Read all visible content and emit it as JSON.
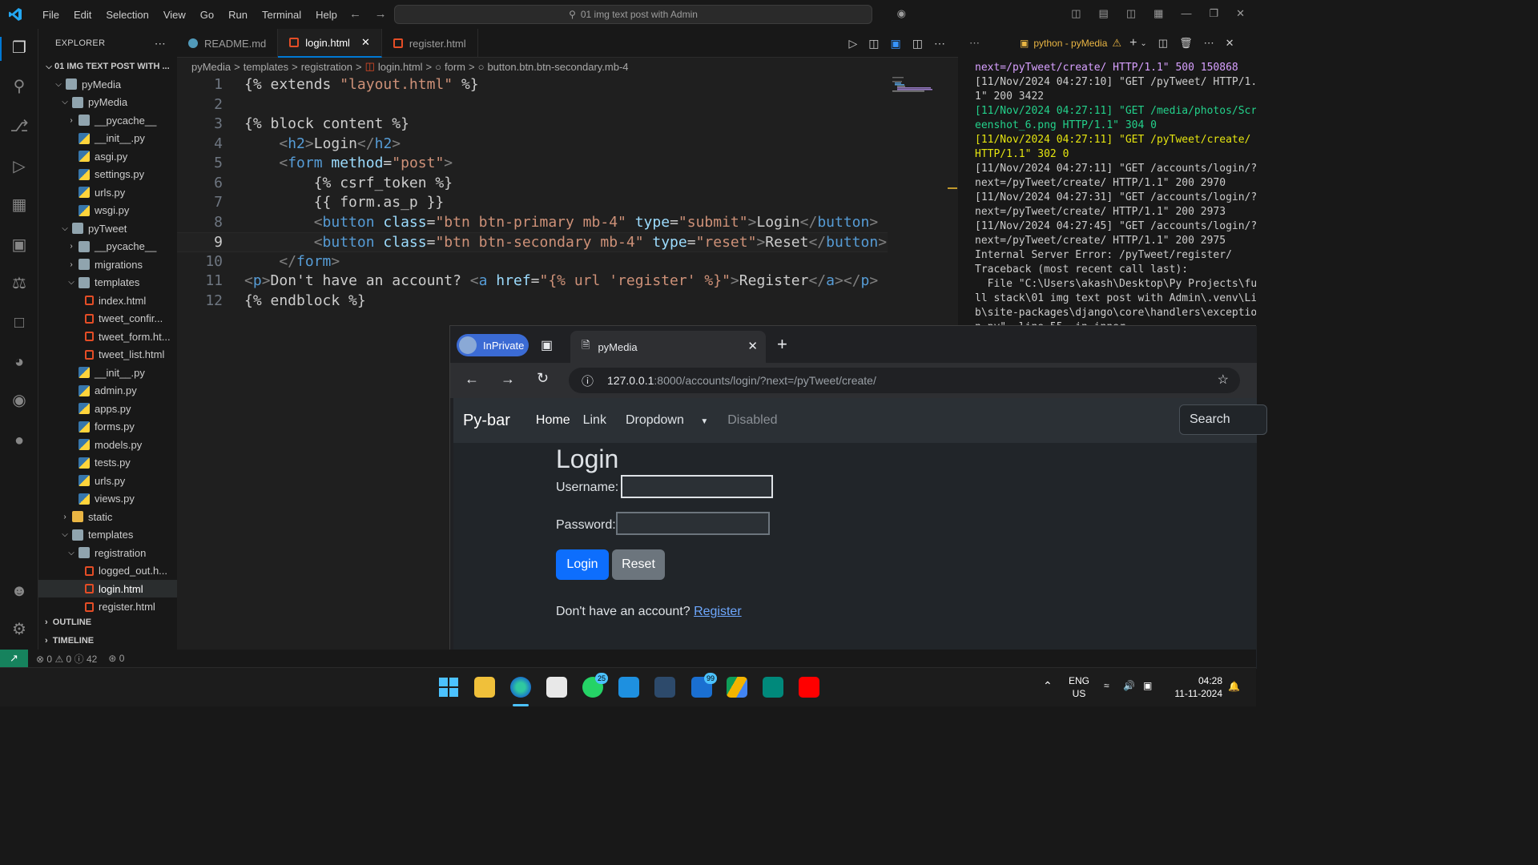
{
  "titlebar": {
    "menu": [
      "File",
      "Edit",
      "Selection",
      "View",
      "Go",
      "Run",
      "Terminal",
      "Help"
    ],
    "command_center": "01 img text post with Admin"
  },
  "explorer": {
    "header": "EXPLORER",
    "root": "01 IMG TEXT POST WITH ...",
    "items": [
      {
        "label": "pyMedia",
        "type": "folder-open",
        "indent": 1
      },
      {
        "label": "pyMedia",
        "type": "folder-open",
        "indent": 2
      },
      {
        "label": "__pycache__",
        "type": "folder",
        "indent": 3
      },
      {
        "label": "__init__.py",
        "type": "py",
        "indent": 3
      },
      {
        "label": "asgi.py",
        "type": "py",
        "indent": 3
      },
      {
        "label": "settings.py",
        "type": "py",
        "indent": 3
      },
      {
        "label": "urls.py",
        "type": "py",
        "indent": 3
      },
      {
        "label": "wsgi.py",
        "type": "py",
        "indent": 3
      },
      {
        "label": "pyTweet",
        "type": "folder-open",
        "indent": 2
      },
      {
        "label": "__pycache__",
        "type": "folder",
        "indent": 3
      },
      {
        "label": "migrations",
        "type": "folder",
        "indent": 3
      },
      {
        "label": "templates",
        "type": "folder-open",
        "indent": 3
      },
      {
        "label": "index.html",
        "type": "html",
        "indent": 4
      },
      {
        "label": "tweet_confir...",
        "type": "html",
        "indent": 4
      },
      {
        "label": "tweet_form.ht...",
        "type": "html",
        "indent": 4
      },
      {
        "label": "tweet_list.html",
        "type": "html",
        "indent": 4
      },
      {
        "label": "__init__.py",
        "type": "py",
        "indent": 3
      },
      {
        "label": "admin.py",
        "type": "py",
        "indent": 3
      },
      {
        "label": "apps.py",
        "type": "py",
        "indent": 3
      },
      {
        "label": "forms.py",
        "type": "py",
        "indent": 3
      },
      {
        "label": "models.py",
        "type": "py",
        "indent": 3
      },
      {
        "label": "tests.py",
        "type": "py",
        "indent": 3
      },
      {
        "label": "urls.py",
        "type": "py",
        "indent": 3
      },
      {
        "label": "views.py",
        "type": "py",
        "indent": 3
      },
      {
        "label": "static",
        "type": "yfolder",
        "indent": 2
      },
      {
        "label": "templates",
        "type": "folder-open",
        "indent": 2
      },
      {
        "label": "registration",
        "type": "folder-open",
        "indent": 3
      },
      {
        "label": "logged_out.h...",
        "type": "html",
        "indent": 4
      },
      {
        "label": "login.html",
        "type": "html",
        "indent": 4,
        "selected": true
      },
      {
        "label": "register.html",
        "type": "html",
        "indent": 4
      }
    ],
    "outline": "OUTLINE",
    "timeline": "TIMELINE"
  },
  "tabs": [
    {
      "label": "README.md",
      "active": false
    },
    {
      "label": "login.html",
      "active": true
    },
    {
      "label": "register.html",
      "active": false
    }
  ],
  "breadcrumb": [
    "pyMedia",
    ">",
    "templates",
    ">",
    "registration",
    ">",
    "login.html",
    ">",
    "form",
    ">",
    "button.btn.btn-secondary.mb-4"
  ],
  "code_lines": [
    "{% extends \"layout.html\" %}",
    "",
    "{% block content %}",
    "    <h2>Login</h2>",
    "    <form method=\"post\">",
    "        {% csrf_token %}",
    "        {{ form.as_p }}",
    "        <button class=\"btn btn-primary mb-4\" type=\"submit\">Login</button>",
    "        <button class=\"btn btn-secondary mb-4\" type=\"reset\">Reset</button>",
    "    </form>",
    "<p>Don't have an account? <a href=\"{% url 'register' %}\">Register</a></p>",
    "{% endblock %}"
  ],
  "current_line": 9,
  "terminal": {
    "tab_label": "python - pyMedia",
    "lines": [
      {
        "text": "next=/pyTweet/create/ HTTP/1.1\" 500 150868",
        "color": "#d7a0ff"
      },
      {
        "text": "[11/Nov/2024 04:27:10] \"GET /pyTweet/ HTTP/1.",
        "color": "#cccccc"
      },
      {
        "text": "1\" 200 3422",
        "color": "#cccccc"
      },
      {
        "text": "[11/Nov/2024 04:27:11] \"GET /media/photos/Scr",
        "color": "#23d18b"
      },
      {
        "text": "eenshot_6.png HTTP/1.1\" 304 0",
        "color": "#23d18b"
      },
      {
        "text": "[11/Nov/2024 04:27:11] \"GET /pyTweet/create/",
        "color": "#e5e510"
      },
      {
        "text": "HTTP/1.1\" 302 0",
        "color": "#e5e510"
      },
      {
        "text": "[11/Nov/2024 04:27:11] \"GET /accounts/login/?",
        "color": "#cccccc"
      },
      {
        "text": "next=/pyTweet/create/ HTTP/1.1\" 200 2970",
        "color": "#cccccc"
      },
      {
        "text": "[11/Nov/2024 04:27:31] \"GET /accounts/login/?",
        "color": "#cccccc"
      },
      {
        "text": "next=/pyTweet/create/ HTTP/1.1\" 200 2973",
        "color": "#cccccc"
      },
      {
        "text": "[11/Nov/2024 04:27:45] \"GET /accounts/login/?",
        "color": "#cccccc"
      },
      {
        "text": "next=/pyTweet/create/ HTTP/1.1\" 200 2975",
        "color": "#cccccc"
      },
      {
        "text": "Internal Server Error: /pyTweet/register/",
        "color": "#cccccc"
      },
      {
        "text": "Traceback (most recent call last):",
        "color": "#cccccc"
      },
      {
        "text": "  File \"C:\\Users\\akash\\Desktop\\Py Projects\\fu",
        "color": "#cccccc"
      },
      {
        "text": "ll stack\\01 img text post with Admin\\.venv\\Li",
        "color": "#cccccc"
      },
      {
        "text": "b\\site-packages\\django\\core\\handlers\\exceptio",
        "color": "#cccccc"
      },
      {
        "text": "n.py\", line 55, in inner",
        "color": "#cccccc"
      }
    ]
  },
  "browser": {
    "inprivate_label": "InPrivate",
    "tab_title": "pyMedia",
    "url_host": "127.0.0.1",
    "url_rest": ":8000/accounts/login/?next=/pyTweet/create/",
    "navbar": {
      "brand": "Py-bar",
      "links": [
        "Home",
        "Link",
        "Dropdown",
        "Disabled"
      ],
      "search": "Search"
    },
    "page": {
      "heading": "Login",
      "username_label": "Username:",
      "password_label": "Password:",
      "login_btn": "Login",
      "reset_btn": "Reset",
      "register_prompt": "Don't have an account?",
      "register_link": "Register"
    }
  },
  "statusbar": {
    "errors": "0",
    "warnings": "0",
    "info": "42",
    "ports": "0"
  },
  "taskbar": {
    "whatsapp_badge": "25",
    "outlook_badge": "99",
    "lang_top": "ENG",
    "lang_bottom": "US",
    "time": "04:28",
    "date": "11-11-2024"
  }
}
